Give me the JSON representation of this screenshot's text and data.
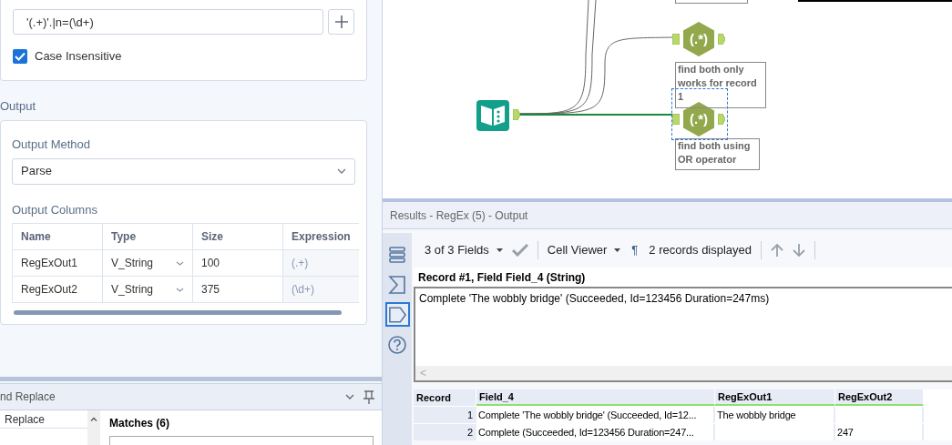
{
  "config": {
    "regex": "'(.+)'.|n=(\\d+)",
    "case_insensitive": {
      "label": "Case Insensitive",
      "checked": true
    },
    "output_heading": "Output",
    "output_method_label": "Output Method",
    "output_method": "Parse",
    "output_columns_label": "Output Columns",
    "columns": [
      "Name",
      "Type",
      "Size",
      "Expression"
    ],
    "rows": [
      [
        "RegExOut1",
        "V_String",
        "100",
        "(.+)"
      ],
      [
        "RegExOut2",
        "V_String",
        "375",
        "(\\d+)"
      ]
    ]
  },
  "find_replace": {
    "title": "nd Replace",
    "list_item": "Replace",
    "matches": "Matches (6)"
  },
  "canvas": {
    "nodes": [
      {
        "kind": "input",
        "selected": false
      },
      {
        "kind": "regex",
        "label": "(.*)",
        "selected": false
      },
      {
        "kind": "regex",
        "label": "(.*)",
        "selected": true
      }
    ],
    "annotations": [
      "find both only works for record 1",
      "find both using OR operator"
    ]
  },
  "results": {
    "title": "Results - RegEx (5) - Output",
    "side_tools": [
      {
        "kind": "list",
        "selected": false
      },
      {
        "kind": "sigma",
        "selected": false
      },
      {
        "kind": "tag",
        "selected": true
      },
      {
        "kind": "help",
        "selected": false
      }
    ],
    "fields": "3 of 3 Fields",
    "viewer": "Cell Viewer",
    "pilcrow": "¶",
    "records": "2 records displayed",
    "cell_title": "Record #1, Field Field_4 (String)",
    "cell_value": "Complete 'The wobbly bridge' (Succeeded, Id=123456 Duration=247ms)",
    "scroll_left": "<",
    "columns": [
      "Record",
      "Field_4",
      "RegExOut1",
      "RegExOut2"
    ],
    "rows": [
      [
        "1",
        "Complete 'The wobbly bridge' (Succeeded, Id=12...",
        "The wobbly bridge",
        ""
      ],
      [
        "2",
        "Complete (Succeeded, Id=123456 Duration=247...",
        "",
        "247"
      ]
    ]
  }
}
